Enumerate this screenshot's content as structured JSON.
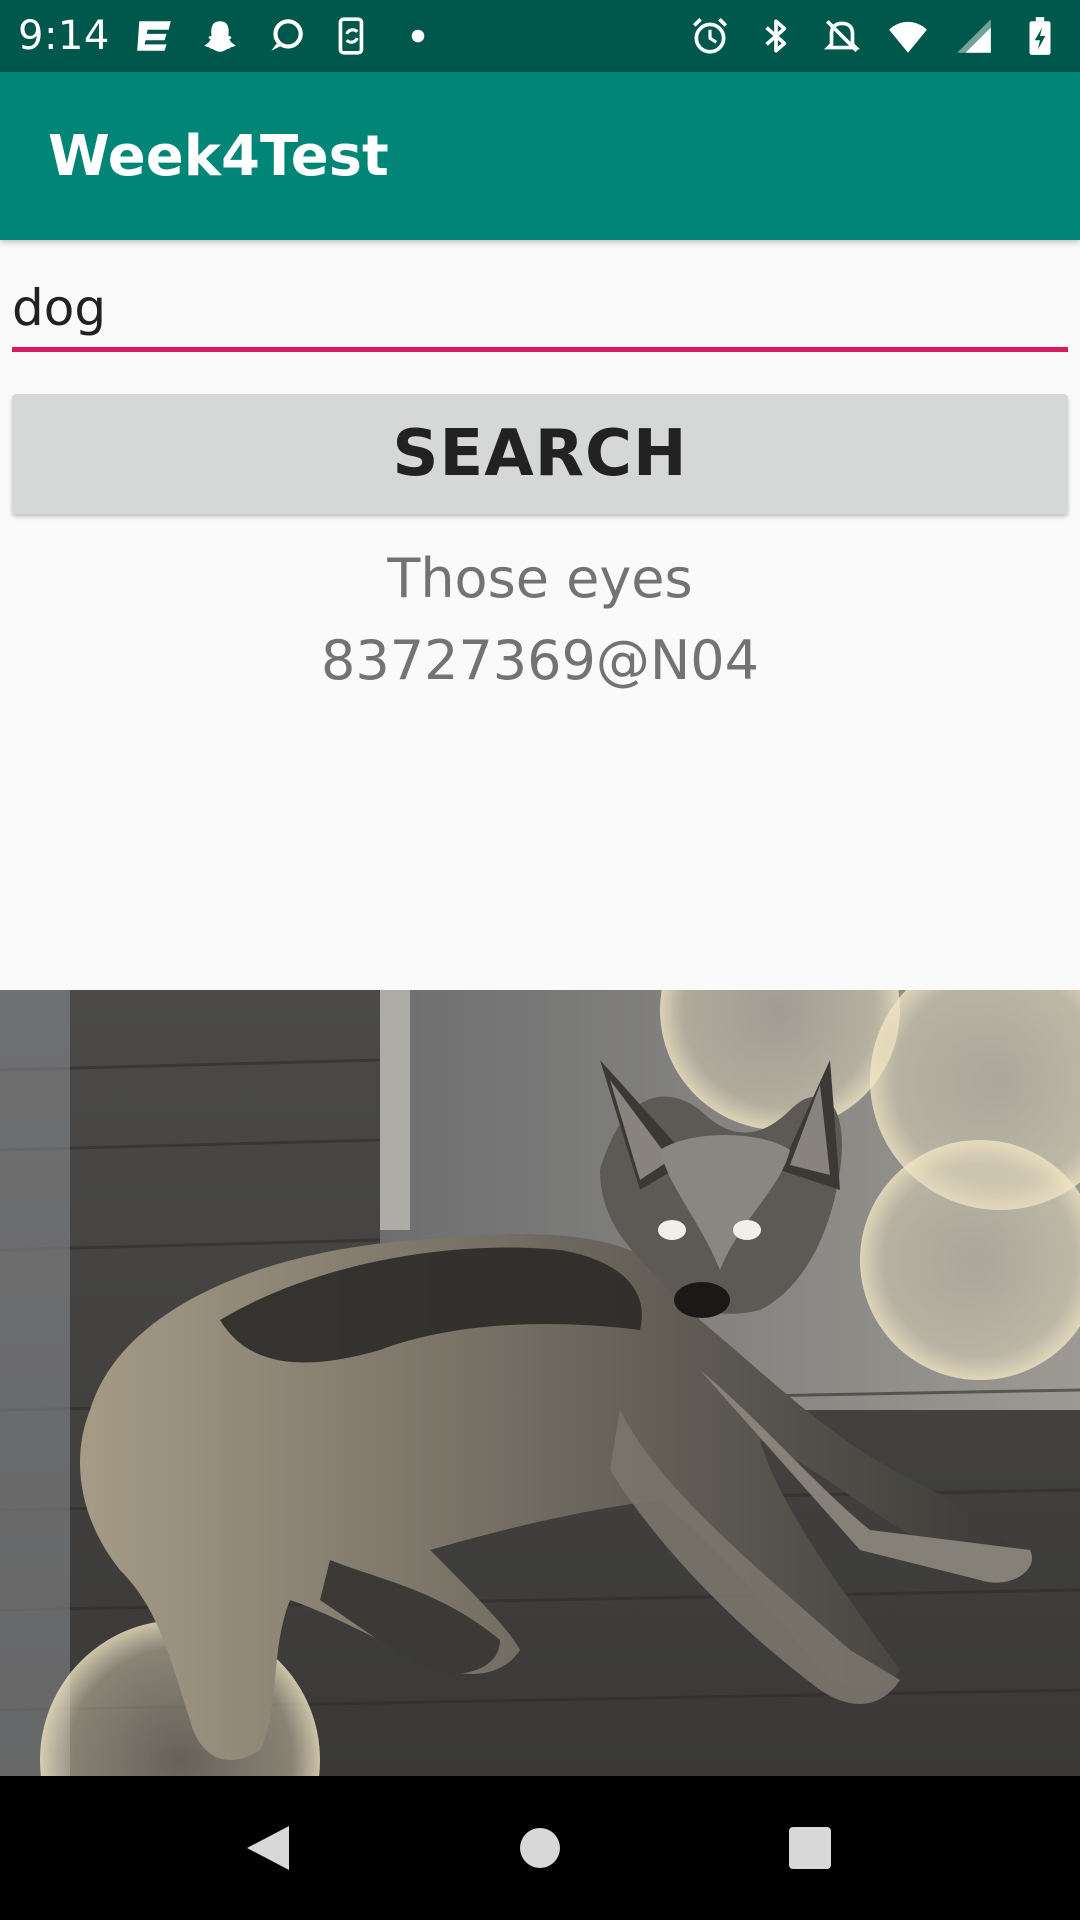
{
  "status_bar": {
    "time": "9:14",
    "left_icons": [
      "e-icon",
      "snapchat-icon",
      "chat-bubble-icon",
      "phone-sync-icon",
      "dot-icon"
    ],
    "right_icons": [
      "alarm-icon",
      "bluetooth-icon",
      "notifications-off-icon",
      "wifi-icon",
      "signal-icon",
      "battery-icon"
    ]
  },
  "app_bar": {
    "title": "Week4Test"
  },
  "search": {
    "value": "dog",
    "button_label": "SEARCH"
  },
  "result": {
    "title": "Those eyes",
    "owner": "83727369@N04"
  },
  "photo": {
    "subject": "dog-photo"
  },
  "nav": {
    "icons": [
      "back-icon",
      "home-icon",
      "recents-icon"
    ]
  },
  "colors": {
    "status_bar": "#00574b",
    "app_bar": "#008577",
    "accent": "#d81b60",
    "button": "#d6d7d7",
    "result_text": "#737373"
  }
}
